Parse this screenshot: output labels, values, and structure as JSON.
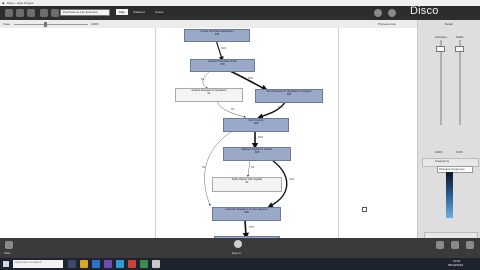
{
  "window": {
    "title": "Disco - Auto Project"
  },
  "toolbar": {
    "project_label": "Purchase-to-pay Example",
    "tabs": [
      {
        "label": "Map"
      },
      {
        "label": "Statistics"
      },
      {
        "label": "Cases"
      }
    ],
    "brand": "Disco"
  },
  "slider_bar": {
    "left_label": "Case",
    "right_label": "100%",
    "center_label": "Process map"
  },
  "process_map": {
    "nodes": [
      {
        "id": "n1",
        "label": "Create Purchase Requisition",
        "count": "608"
      },
      {
        "id": "n2",
        "label": "Approve Purchase Order",
        "count": "608"
      },
      {
        "id": "n3",
        "label": "Analyze Request for Quotation",
        "count": "51"
      },
      {
        "id": "n4",
        "label": "Send Request for Quotation to Supplier",
        "count": "608"
      },
      {
        "id": "n5",
        "label": "Send Invoice",
        "count": "608"
      },
      {
        "id": "n6",
        "label": "Release Supplier's Invoice",
        "count": "608"
      },
      {
        "id": "n7",
        "label": "Settle dispute with supplier",
        "count": "51"
      },
      {
        "id": "n8",
        "label": "Authorize Supplier's Invoice payment",
        "count": "608"
      }
    ],
    "edge_labels": [
      "609",
      "554",
      "54",
      "54",
      "577",
      "608",
      "89",
      "54",
      "419",
      "578"
    ]
  },
  "right_panel": {
    "header": "Detail",
    "slider_labels": [
      "Activities",
      "Paths"
    ],
    "slider_values": [
      "100%",
      "0.0%"
    ],
    "filter_title": "Frequency",
    "filter_option": "Absolute frequency"
  },
  "bottom_bar": {
    "left_label": "Filter",
    "center_label": "Export",
    "right_labels": [
      "Copy",
      "Export",
      "Save"
    ]
  },
  "taskbar": {
    "search_placeholder": "Type here to search",
    "time": "10:01",
    "date": "05/10/2019"
  },
  "colors": {
    "toolbar_bg": "#2d2d2d",
    "node_blue": "#9ba9c9",
    "canvas_bg": "#ffffff"
  }
}
